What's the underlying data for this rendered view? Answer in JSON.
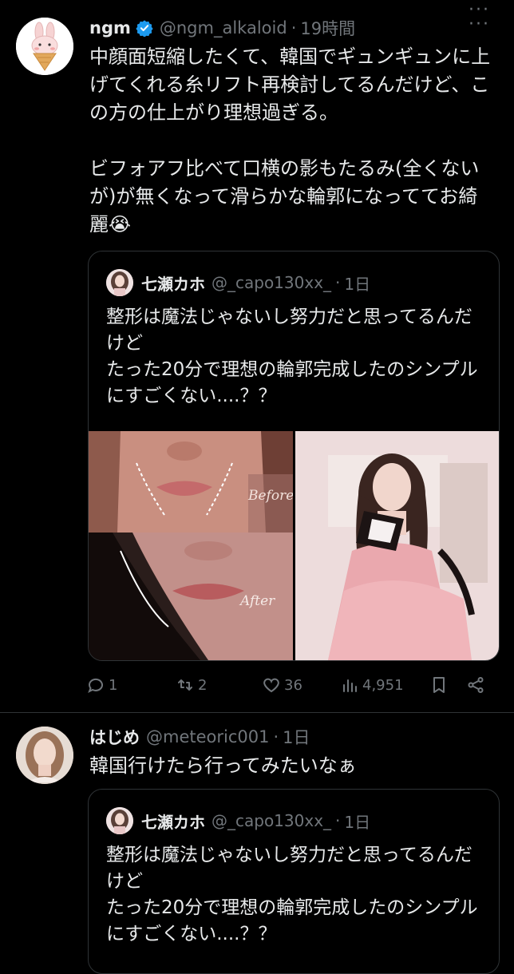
{
  "post1": {
    "name": "ngm",
    "handle": "@ngm_alkaloid",
    "dot": "·",
    "time": "19時間",
    "text": "中顔面短縮したくて、韓国でギュンギュンに上げてくれる糸リフト再検討してるんだけど、この方の仕上がり理想過ぎる。\n\nビフォアフ比べて口横の影もたるみ(全くないが)が無くなって滑らかな輪郭になっててお綺麗😭",
    "more": "···",
    "quote": {
      "name": "七瀬カホ",
      "handle": "@_capo130xx_",
      "dot": "·",
      "time": "1日",
      "text": "整形は魔法じゃないし努力だと思ってるんだけど\nたった20分で理想の輪郭完成したのシンプルにすごくない....？？",
      "image_before_label": "Before",
      "image_after_label": "After"
    },
    "actions": {
      "reply_count": "1",
      "repost_count": "2",
      "like_count": "36",
      "views_count": "4,951"
    }
  },
  "post2": {
    "name": "はじめ",
    "handle": "@meteoric001",
    "dot": "·",
    "time": "1日",
    "text": "韓国行けたら行ってみたいなぁ",
    "more": "···",
    "quote": {
      "name": "七瀬カホ",
      "handle": "@_capo130xx_",
      "dot": "·",
      "time": "1日",
      "text": "整形は魔法じゃないし努力だと思ってるんだけど\nたった20分で理想の輪郭完成したのシンプルにすごくない....？？"
    }
  },
  "colors": {
    "background": "#000000",
    "text": "#e7e9ea",
    "secondary": "#71767b",
    "border": "#2f3336",
    "verified": "#1d9bf0"
  }
}
